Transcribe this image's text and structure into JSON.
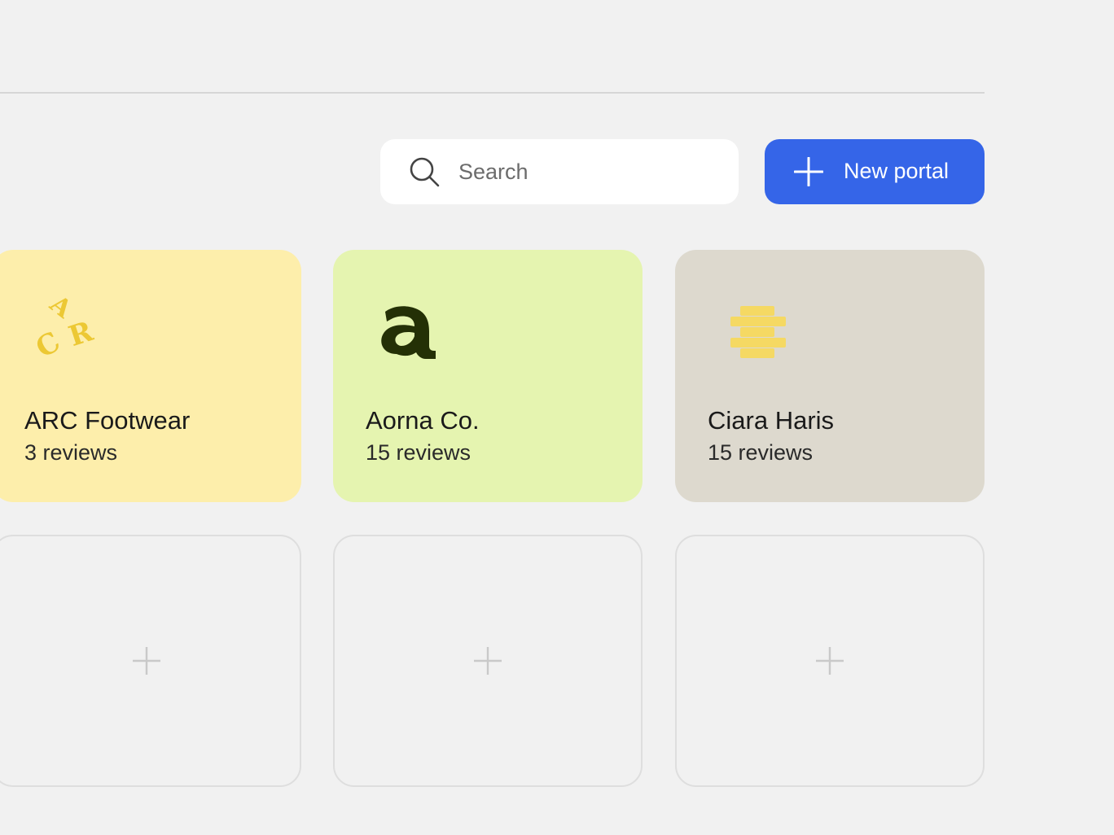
{
  "search": {
    "placeholder": "Search",
    "value": ""
  },
  "toolbar": {
    "new_portal_label": "New portal",
    "button_color": "#3565e8",
    "icons": {
      "search": "search-icon",
      "new": "plus-icon"
    }
  },
  "portals": [
    {
      "name": "ARC Footwear",
      "reviews": "3 reviews",
      "color": "#fdeeab",
      "logo": "arc-logo-icon"
    },
    {
      "name": "Aorna Co.",
      "reviews": "15 reviews",
      "color": "#e5f4b0",
      "logo": "aorna-logo-icon"
    },
    {
      "name": "Ciara Haris",
      "reviews": "15 reviews",
      "color": "#ddd9ce",
      "logo": "ciara-logo-icon"
    }
  ],
  "empty_slots": [
    {
      "icon": "plus-icon"
    },
    {
      "icon": "plus-icon"
    },
    {
      "icon": "plus-icon"
    }
  ]
}
